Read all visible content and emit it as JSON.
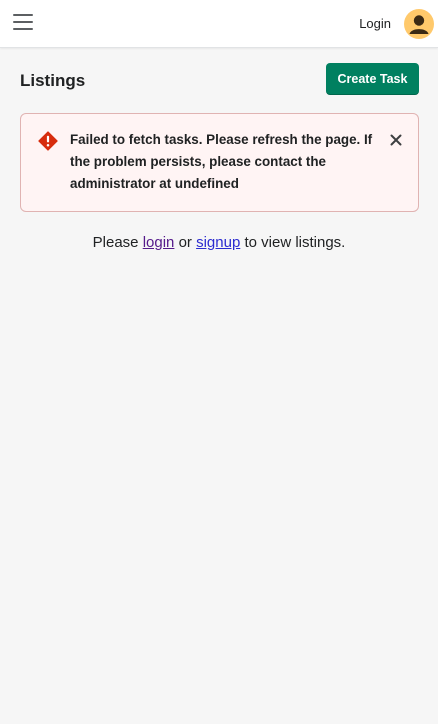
{
  "topbar": {
    "menu_icon": "hamburger-menu-icon",
    "login_label": "Login",
    "avatar_icon": "user-avatar-icon",
    "avatar_color": "#ffc96b"
  },
  "page": {
    "title": "Listings",
    "create_button_label": "Create Task",
    "accent_color": "#008060"
  },
  "error_banner": {
    "icon": "error-diamond-icon",
    "message": "Failed to fetch tasks. Please refresh the page. If the problem persists, please contact the administrator at undefined",
    "close_icon": "close-icon",
    "critical_color": "#d72c0d"
  },
  "empty_state": {
    "prefix": "Please ",
    "login_link": "login",
    "middle": " or ",
    "signup_link": "signup",
    "suffix": " to view listings."
  }
}
